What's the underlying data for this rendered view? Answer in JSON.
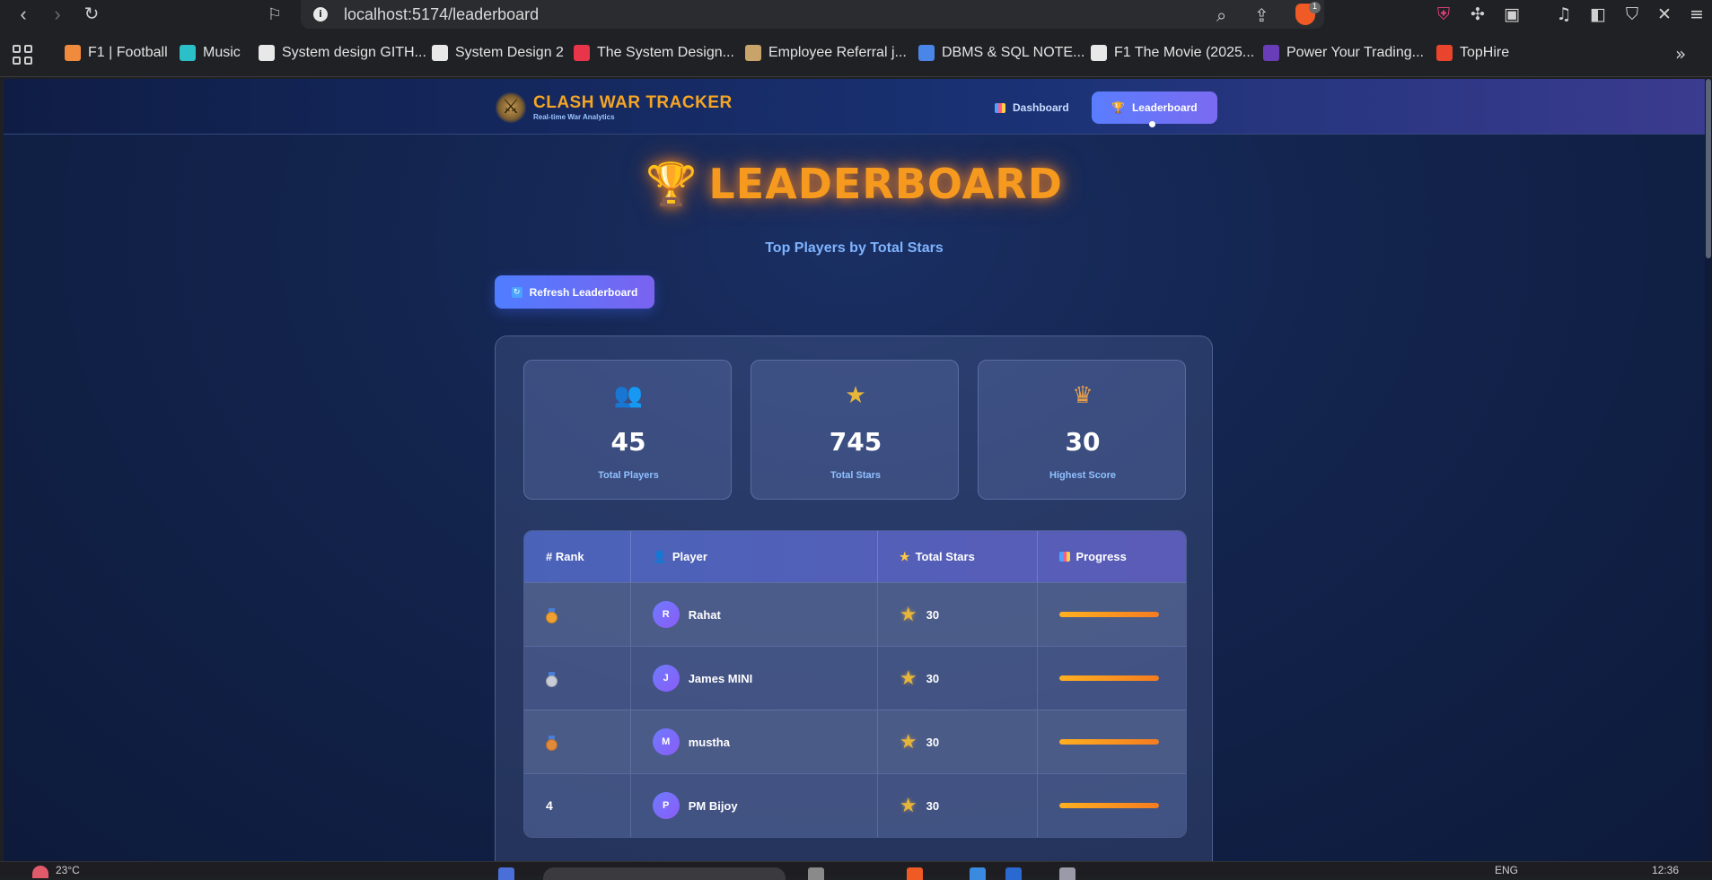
{
  "browser": {
    "url": "localhost:5174/leaderboard",
    "bookmarks": [
      {
        "label": "F1 | Football",
        "color": "#f08a3c"
      },
      {
        "label": "Music",
        "color": "#2bc0c8"
      },
      {
        "label": "System design GITH...",
        "color": "#e8e8e8"
      },
      {
        "label": "System Design 2",
        "color": "#e8e8e8"
      },
      {
        "label": "The System Design...",
        "color": "#e8354a"
      },
      {
        "label": "Employee Referral j...",
        "color": "#c9a46a"
      },
      {
        "label": "DBMS & SQL NOTE...",
        "color": "#4a86e8"
      },
      {
        "label": "F1 The Movie (2025...",
        "color": "#e8e8e8"
      },
      {
        "label": "Power Your Trading...",
        "color": "#6a3db8"
      },
      {
        "label": "TopHire",
        "color": "#e8452c"
      }
    ]
  },
  "app": {
    "brand_title": "CLASH WAR TRACKER",
    "brand_subtitle": "Real-time War Analytics",
    "nav": {
      "dashboard": "Dashboard",
      "leaderboard": "Leaderboard"
    },
    "accent_color": "#f59a1e"
  },
  "page": {
    "title": "LEADERBOARD",
    "subtitle": "Top Players by Total Stars",
    "refresh_label": "Refresh Leaderboard"
  },
  "stats": [
    {
      "value": "45",
      "label": "Total Players",
      "icon": "players-icon"
    },
    {
      "value": "745",
      "label": "Total Stars",
      "icon": "star-icon"
    },
    {
      "value": "30",
      "label": "Highest Score",
      "icon": "crown-icon"
    }
  ],
  "table": {
    "headers": {
      "rank": "# Rank",
      "player": "Player",
      "stars": "Total Stars",
      "progress": "Progress"
    },
    "rows": [
      {
        "rank": "",
        "medal": "gold",
        "initial": "R",
        "player": "Rahat",
        "stars": "30",
        "progress": 1.0
      },
      {
        "rank": "",
        "medal": "silver",
        "initial": "J",
        "player": "James MINI",
        "stars": "30",
        "progress": 1.0
      },
      {
        "rank": "",
        "medal": "bronze",
        "initial": "M",
        "player": "mustha",
        "stars": "30",
        "progress": 1.0
      },
      {
        "rank": "4",
        "medal": "",
        "initial": "P",
        "player": "PM Bijoy",
        "stars": "30",
        "progress": 1.0
      }
    ]
  },
  "taskbar": {
    "temperature": "23°C",
    "language": "ENG",
    "time": "12:36"
  }
}
